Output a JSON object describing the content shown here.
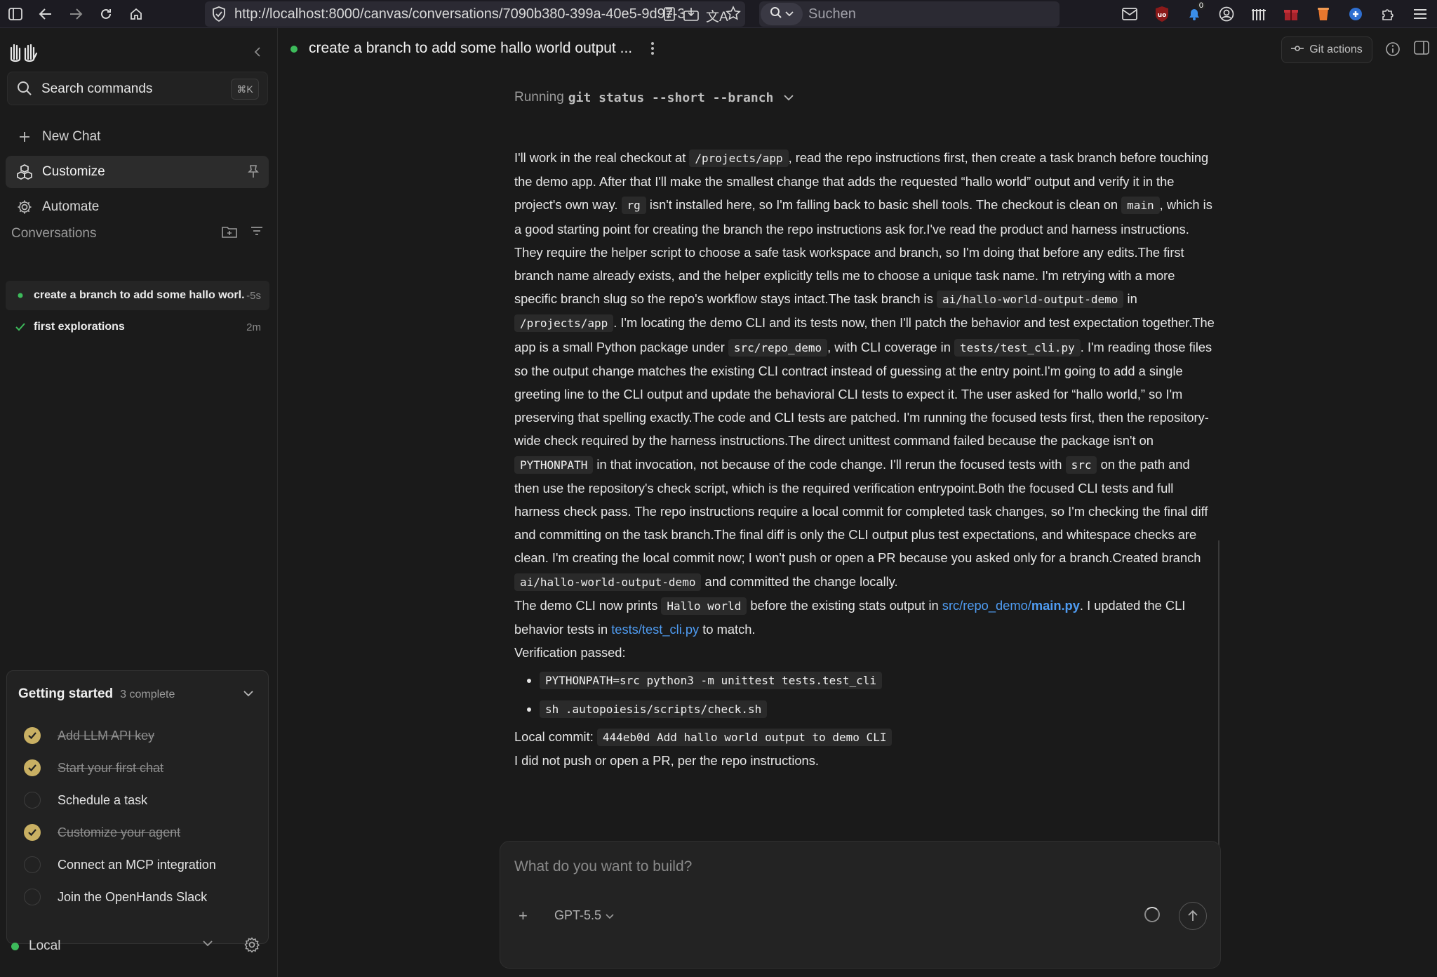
{
  "browser": {
    "url": "http://localhost:8000/canvas/conversations/7090b380-399a-40e5-9d97-3",
    "search_placeholder": "Suchen",
    "notification_badge": "0"
  },
  "sidebar": {
    "search": {
      "label": "Search commands",
      "shortcut": "⌘K"
    },
    "nav": {
      "new_chat": "New Chat",
      "customize": "Customize",
      "automate": "Automate"
    },
    "conversations_title": "Conversations",
    "conversations": [
      {
        "title": "create a branch to add some hallo worl...",
        "time": "-5s",
        "status": "running"
      },
      {
        "title": "first explorations",
        "time": "2m",
        "status": "done"
      }
    ],
    "getting_started": {
      "title": "Getting started",
      "count": "3 complete",
      "items": [
        {
          "label": "Add LLM API key",
          "done": true
        },
        {
          "label": "Start your first chat",
          "done": true
        },
        {
          "label": "Schedule a task",
          "done": false
        },
        {
          "label": "Customize your agent",
          "done": true
        },
        {
          "label": "Connect an MCP integration",
          "done": false
        },
        {
          "label": "Join the OpenHands Slack",
          "done": false
        }
      ]
    },
    "runtime": {
      "label": "Local",
      "status_color": "#3dbb5b"
    }
  },
  "chat": {
    "title": "create a branch to add some hallo world output ...",
    "git_actions": "Git actions",
    "running_prefix": "Running",
    "running_command": "git status --short --branch",
    "message": {
      "p1": "I'll work in the real checkout at",
      "c1": "/projects/app",
      "p2": ", read the repo instructions first, then create a task branch before touching the demo app. After that I'll make the smallest change that adds the requested “hallo world” output and verify it in the project's own way.",
      "c2": "rg",
      "p3": "isn't installed here, so I'm falling back to basic shell tools. The checkout is clean on",
      "c3": "main",
      "p4": ", which is a good starting point for creating the branch the repo instructions ask for.I've read the product and harness instructions. They require the helper script to choose a safe task workspace and branch, so I'm doing that before any edits.The first branch name already exists, and the helper explicitly tells me to choose a unique task name. I'm retrying with a more specific branch slug so the repo's workflow stays intact.The task branch is",
      "c4": "ai/hallo-world-output-demo",
      "p5": "in",
      "c5": "/projects/app",
      "p6": ". I'm locating the demo CLI and its tests now, then I'll patch the behavior and test expectation together.The app is a small Python package under",
      "c6": "src/repo_demo",
      "p7": ", with CLI coverage in",
      "c7": "tests/test_cli.py",
      "p8": ". I'm reading those files so the output change matches the existing CLI contract instead of guessing at the entry point.I'm going to add a single greeting line to the CLI output and update the behavioral CLI tests to expect it. The user asked for “hallo world,” so I'm preserving that spelling exactly.The code and CLI tests are patched. I'm running the focused tests first, then the repository-wide check required by the harness instructions.The direct unittest command failed because the package isn't on",
      "c8": "PYTHONPATH",
      "p9": "in that invocation, not because of the code change. I'll rerun the focused tests with",
      "c9": "src",
      "p10": "on the path and then use the repository's check script, which is the required verification entrypoint.Both the focused CLI tests and full harness check pass. The repo instructions require a local commit for completed task changes, so I'm checking the final diff and committing on the task branch.The final diff is only the CLI output plus test expectations, and whitespace checks are clean. I'm creating the local commit now; I won't push or open a PR because you asked only for a branch.Created branch",
      "c10": "ai/hallo-world-output-demo",
      "p11": "and committed the change locally.",
      "s2_a": "The demo CLI now prints",
      "s2_code": "Hallo world",
      "s2_b": "before the existing stats output in",
      "s2_link_dir": "src/repo_demo/",
      "s2_link_file": "main.py",
      "s2_c": ". I updated the CLI behavior tests in",
      "s2_link2": "tests/test_cli.py",
      "s2_d": "to match.",
      "verify_title": "Verification passed:",
      "verify_1": "PYTHONPATH=src python3 -m unittest tests.test_cli",
      "verify_2": "sh .autopoiesis/scripts/check.sh",
      "commit_label": "Local commit:",
      "commit_value": "444eb0d Add hallo world output to demo CLI",
      "final": "I did not push or open a PR, per the repo instructions."
    }
  },
  "composer": {
    "placeholder": "What do you want to build?",
    "add": "+",
    "model": "GPT-5.5"
  },
  "colors": {
    "accent_link": "#4f9cf2",
    "status_green": "#3dbb5b",
    "check_gold": "#c9b063"
  }
}
